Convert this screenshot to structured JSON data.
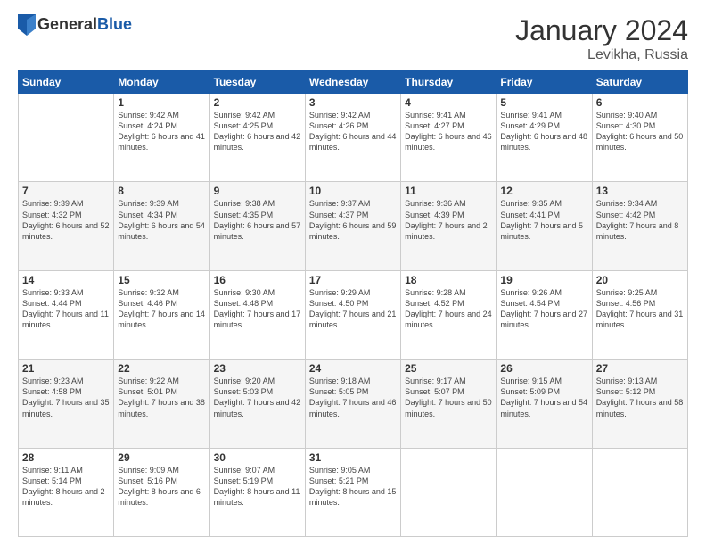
{
  "header": {
    "logo": {
      "general": "General",
      "blue": "Blue"
    },
    "title": "January 2024",
    "location": "Levikha, Russia"
  },
  "days_of_week": [
    "Sunday",
    "Monday",
    "Tuesday",
    "Wednesday",
    "Thursday",
    "Friday",
    "Saturday"
  ],
  "weeks": [
    [
      {
        "day": "",
        "info": ""
      },
      {
        "day": "1",
        "info": "Sunrise: 9:42 AM\nSunset: 4:24 PM\nDaylight: 6 hours\nand 41 minutes."
      },
      {
        "day": "2",
        "info": "Sunrise: 9:42 AM\nSunset: 4:25 PM\nDaylight: 6 hours\nand 42 minutes."
      },
      {
        "day": "3",
        "info": "Sunrise: 9:42 AM\nSunset: 4:26 PM\nDaylight: 6 hours\nand 44 minutes."
      },
      {
        "day": "4",
        "info": "Sunrise: 9:41 AM\nSunset: 4:27 PM\nDaylight: 6 hours\nand 46 minutes."
      },
      {
        "day": "5",
        "info": "Sunrise: 9:41 AM\nSunset: 4:29 PM\nDaylight: 6 hours\nand 48 minutes."
      },
      {
        "day": "6",
        "info": "Sunrise: 9:40 AM\nSunset: 4:30 PM\nDaylight: 6 hours\nand 50 minutes."
      }
    ],
    [
      {
        "day": "7",
        "info": "Sunrise: 9:39 AM\nSunset: 4:32 PM\nDaylight: 6 hours\nand 52 minutes."
      },
      {
        "day": "8",
        "info": "Sunrise: 9:39 AM\nSunset: 4:34 PM\nDaylight: 6 hours\nand 54 minutes."
      },
      {
        "day": "9",
        "info": "Sunrise: 9:38 AM\nSunset: 4:35 PM\nDaylight: 6 hours\nand 57 minutes."
      },
      {
        "day": "10",
        "info": "Sunrise: 9:37 AM\nSunset: 4:37 PM\nDaylight: 6 hours\nand 59 minutes."
      },
      {
        "day": "11",
        "info": "Sunrise: 9:36 AM\nSunset: 4:39 PM\nDaylight: 7 hours\nand 2 minutes."
      },
      {
        "day": "12",
        "info": "Sunrise: 9:35 AM\nSunset: 4:41 PM\nDaylight: 7 hours\nand 5 minutes."
      },
      {
        "day": "13",
        "info": "Sunrise: 9:34 AM\nSunset: 4:42 PM\nDaylight: 7 hours\nand 8 minutes."
      }
    ],
    [
      {
        "day": "14",
        "info": "Sunrise: 9:33 AM\nSunset: 4:44 PM\nDaylight: 7 hours\nand 11 minutes."
      },
      {
        "day": "15",
        "info": "Sunrise: 9:32 AM\nSunset: 4:46 PM\nDaylight: 7 hours\nand 14 minutes."
      },
      {
        "day": "16",
        "info": "Sunrise: 9:30 AM\nSunset: 4:48 PM\nDaylight: 7 hours\nand 17 minutes."
      },
      {
        "day": "17",
        "info": "Sunrise: 9:29 AM\nSunset: 4:50 PM\nDaylight: 7 hours\nand 21 minutes."
      },
      {
        "day": "18",
        "info": "Sunrise: 9:28 AM\nSunset: 4:52 PM\nDaylight: 7 hours\nand 24 minutes."
      },
      {
        "day": "19",
        "info": "Sunrise: 9:26 AM\nSunset: 4:54 PM\nDaylight: 7 hours\nand 27 minutes."
      },
      {
        "day": "20",
        "info": "Sunrise: 9:25 AM\nSunset: 4:56 PM\nDaylight: 7 hours\nand 31 minutes."
      }
    ],
    [
      {
        "day": "21",
        "info": "Sunrise: 9:23 AM\nSunset: 4:58 PM\nDaylight: 7 hours\nand 35 minutes."
      },
      {
        "day": "22",
        "info": "Sunrise: 9:22 AM\nSunset: 5:01 PM\nDaylight: 7 hours\nand 38 minutes."
      },
      {
        "day": "23",
        "info": "Sunrise: 9:20 AM\nSunset: 5:03 PM\nDaylight: 7 hours\nand 42 minutes."
      },
      {
        "day": "24",
        "info": "Sunrise: 9:18 AM\nSunset: 5:05 PM\nDaylight: 7 hours\nand 46 minutes."
      },
      {
        "day": "25",
        "info": "Sunrise: 9:17 AM\nSunset: 5:07 PM\nDaylight: 7 hours\nand 50 minutes."
      },
      {
        "day": "26",
        "info": "Sunrise: 9:15 AM\nSunset: 5:09 PM\nDaylight: 7 hours\nand 54 minutes."
      },
      {
        "day": "27",
        "info": "Sunrise: 9:13 AM\nSunset: 5:12 PM\nDaylight: 7 hours\nand 58 minutes."
      }
    ],
    [
      {
        "day": "28",
        "info": "Sunrise: 9:11 AM\nSunset: 5:14 PM\nDaylight: 8 hours\nand 2 minutes."
      },
      {
        "day": "29",
        "info": "Sunrise: 9:09 AM\nSunset: 5:16 PM\nDaylight: 8 hours\nand 6 minutes."
      },
      {
        "day": "30",
        "info": "Sunrise: 9:07 AM\nSunset: 5:19 PM\nDaylight: 8 hours\nand 11 minutes."
      },
      {
        "day": "31",
        "info": "Sunrise: 9:05 AM\nSunset: 5:21 PM\nDaylight: 8 hours\nand 15 minutes."
      },
      {
        "day": "",
        "info": ""
      },
      {
        "day": "",
        "info": ""
      },
      {
        "day": "",
        "info": ""
      }
    ]
  ]
}
